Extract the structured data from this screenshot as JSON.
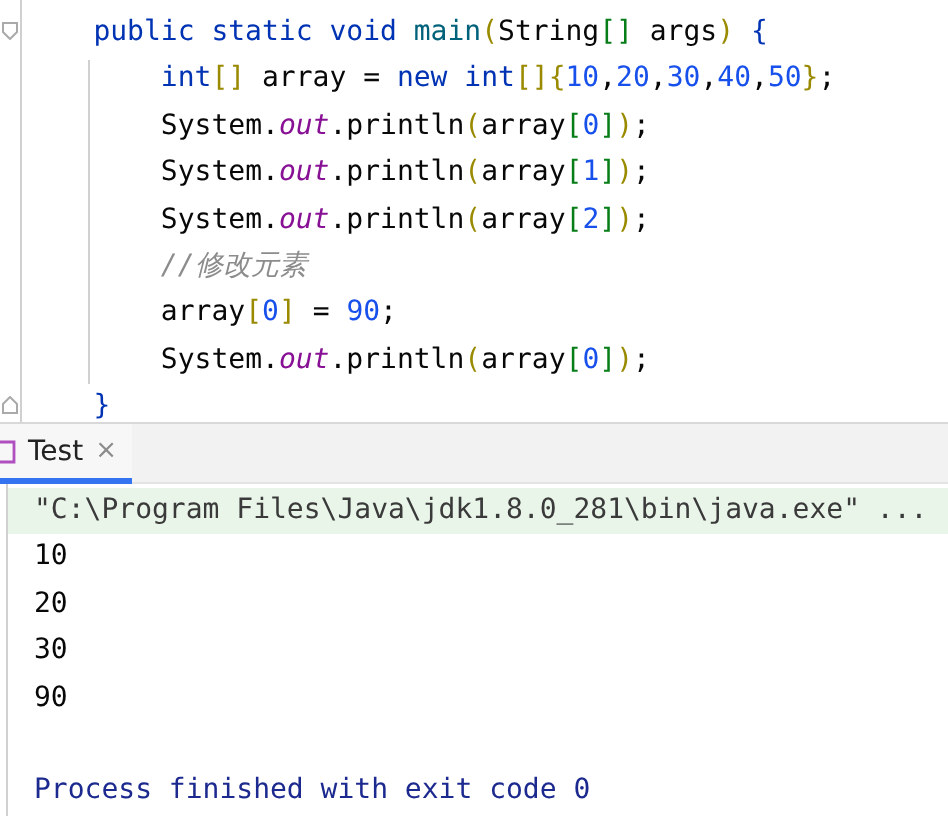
{
  "editor": {
    "lines": [
      {
        "tokens": [
          {
            "kind": "keyword",
            "text": "public static void "
          },
          {
            "kind": "method",
            "text": "main"
          },
          {
            "kind": "bracket",
            "text": "("
          },
          {
            "kind": "plain",
            "text": "String"
          },
          {
            "kind": "bracket2",
            "text": "[]"
          },
          {
            "kind": "plain",
            "text": " args"
          },
          {
            "kind": "bracket",
            "text": ")"
          },
          {
            "kind": "brace",
            "text": " {"
          }
        ],
        "children": [
          {
            "tokens": [
              {
                "kind": "keyword",
                "text": "int"
              },
              {
                "kind": "bracket",
                "text": "[]"
              },
              {
                "kind": "plain",
                "text": " array = "
              },
              {
                "kind": "keyword",
                "text": "new int"
              },
              {
                "kind": "bracket",
                "text": "[]"
              },
              {
                "kind": "bracket",
                "text": "{"
              },
              {
                "kind": "number",
                "text": "10"
              },
              {
                "kind": "plain",
                "text": ","
              },
              {
                "kind": "number",
                "text": "20"
              },
              {
                "kind": "plain",
                "text": ","
              },
              {
                "kind": "number",
                "text": "30"
              },
              {
                "kind": "plain",
                "text": ","
              },
              {
                "kind": "number",
                "text": "40"
              },
              {
                "kind": "plain",
                "text": ","
              },
              {
                "kind": "number",
                "text": "50"
              },
              {
                "kind": "bracket",
                "text": "}"
              },
              {
                "kind": "plain",
                "text": ";"
              }
            ]
          },
          {
            "tokens": [
              {
                "kind": "plain",
                "text": "System."
              },
              {
                "kind": "field",
                "text": "out"
              },
              {
                "kind": "plain",
                "text": ".println"
              },
              {
                "kind": "bracket",
                "text": "("
              },
              {
                "kind": "plain",
                "text": "array"
              },
              {
                "kind": "bracket2",
                "text": "["
              },
              {
                "kind": "number",
                "text": "0"
              },
              {
                "kind": "bracket2",
                "text": "]"
              },
              {
                "kind": "bracket",
                "text": ")"
              },
              {
                "kind": "plain",
                "text": ";"
              }
            ]
          },
          {
            "tokens": [
              {
                "kind": "plain",
                "text": "System."
              },
              {
                "kind": "field",
                "text": "out"
              },
              {
                "kind": "plain",
                "text": ".println"
              },
              {
                "kind": "bracket",
                "text": "("
              },
              {
                "kind": "plain",
                "text": "array"
              },
              {
                "kind": "bracket2",
                "text": "["
              },
              {
                "kind": "number",
                "text": "1"
              },
              {
                "kind": "bracket2",
                "text": "]"
              },
              {
                "kind": "bracket",
                "text": ")"
              },
              {
                "kind": "plain",
                "text": ";"
              }
            ]
          },
          {
            "tokens": [
              {
                "kind": "plain",
                "text": "System."
              },
              {
                "kind": "field",
                "text": "out"
              },
              {
                "kind": "plain",
                "text": ".println"
              },
              {
                "kind": "bracket",
                "text": "("
              },
              {
                "kind": "plain",
                "text": "array"
              },
              {
                "kind": "bracket2",
                "text": "["
              },
              {
                "kind": "number",
                "text": "2"
              },
              {
                "kind": "bracket2",
                "text": "]"
              },
              {
                "kind": "bracket",
                "text": ")"
              },
              {
                "kind": "plain",
                "text": ";"
              }
            ]
          },
          {
            "tokens": [
              {
                "kind": "comment",
                "text": "//修改元素"
              }
            ]
          },
          {
            "tokens": [
              {
                "kind": "plain",
                "text": "array"
              },
              {
                "kind": "bracket",
                "text": "["
              },
              {
                "kind": "number",
                "text": "0"
              },
              {
                "kind": "bracket",
                "text": "]"
              },
              {
                "kind": "plain",
                "text": " = "
              },
              {
                "kind": "number",
                "text": "90"
              },
              {
                "kind": "plain",
                "text": ";"
              }
            ]
          },
          {
            "tokens": [
              {
                "kind": "plain",
                "text": "System."
              },
              {
                "kind": "field",
                "text": "out"
              },
              {
                "kind": "plain",
                "text": ".println"
              },
              {
                "kind": "bracket",
                "text": "("
              },
              {
                "kind": "plain",
                "text": "array"
              },
              {
                "kind": "bracket2",
                "text": "["
              },
              {
                "kind": "number",
                "text": "0"
              },
              {
                "kind": "bracket2",
                "text": "]"
              },
              {
                "kind": "bracket",
                "text": ")"
              },
              {
                "kind": "plain",
                "text": ";"
              }
            ]
          }
        ]
      },
      {
        "tokens": [
          {
            "kind": "brace",
            "text": "}"
          }
        ]
      }
    ]
  },
  "run_tabs": [
    {
      "label": "Test",
      "close": "×",
      "selected": true
    }
  ],
  "console": {
    "lines": [
      {
        "kind": "command",
        "text": "\"C:\\Program Files\\Java\\jdk1.8.0_281\\bin\\java.exe\" ..."
      },
      {
        "kind": "output",
        "text": "10"
      },
      {
        "kind": "output",
        "text": "20"
      },
      {
        "kind": "output",
        "text": "30"
      },
      {
        "kind": "output",
        "text": "90"
      },
      {
        "kind": "status",
        "text": "Process finished with exit code 0"
      }
    ]
  }
}
